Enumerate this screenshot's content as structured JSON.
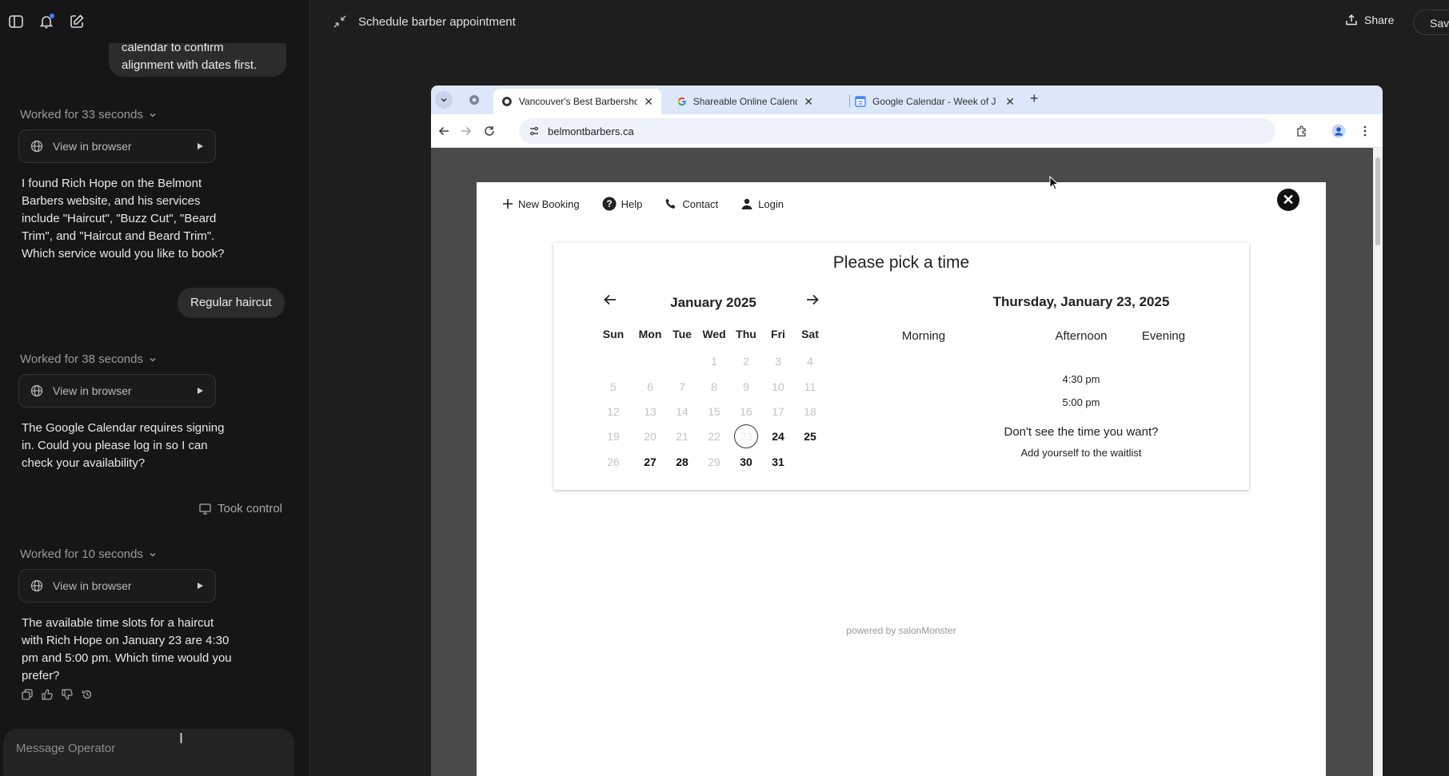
{
  "chat": {
    "partial_message": "calendar to confirm alignment with dates first.",
    "entries": [
      {
        "worked": "Worked for 33 seconds",
        "view_label": "View in browser",
        "message": "I found Rich Hope on the Belmont Barbers website, and his services include \"Haircut\", \"Buzz Cut\", \"Beard Trim\", and \"Haircut and Beard Trim\". Which service would you like to book?"
      },
      {
        "worked": "Worked for 38 seconds",
        "view_label": "View in browser",
        "message": "The Google Calendar requires signing in. Could you please log in so I can check your availability?"
      },
      {
        "worked": "Worked for 10 seconds",
        "view_label": "View in browser",
        "message": "The available time slots for a haircut with Rich Hope on January 23 are 4:30 pm and 5:00 pm. Which time would you prefer?"
      }
    ],
    "user_reply": "Regular haircut",
    "took_control": "Took control",
    "composer_placeholder": "Message Operator"
  },
  "main": {
    "title": "Schedule barber appointment",
    "share_label": "Share",
    "save_label": "Save"
  },
  "browser": {
    "tabs": [
      {
        "title": "Vancouver's Best Barbersho",
        "active": true
      },
      {
        "title": "Shareable Online Calendar a",
        "active": false
      },
      {
        "title": "Google Calendar - Week of J",
        "active": false
      }
    ],
    "url": "belmontbarbers.ca"
  },
  "booking": {
    "nav": {
      "new_booking": "New Booking",
      "help": "Help",
      "contact": "Contact",
      "login": "Login"
    },
    "title": "Please pick a time",
    "month": "January 2025",
    "weekdays": [
      "Sun",
      "Mon",
      "Tue",
      "Wed",
      "Thu",
      "Fri",
      "Sat"
    ],
    "weeks": [
      [
        null,
        null,
        null,
        {
          "d": "1",
          "s": "dis"
        },
        {
          "d": "2",
          "s": "dis"
        },
        {
          "d": "3",
          "s": "dis"
        },
        {
          "d": "4",
          "s": "dis"
        }
      ],
      [
        {
          "d": "5",
          "s": "dis"
        },
        {
          "d": "6",
          "s": "dis"
        },
        {
          "d": "7",
          "s": "dis"
        },
        {
          "d": "8",
          "s": "dis"
        },
        {
          "d": "9",
          "s": "dis"
        },
        {
          "d": "10",
          "s": "dis"
        },
        {
          "d": "11",
          "s": "dis"
        }
      ],
      [
        {
          "d": "12",
          "s": "dis"
        },
        {
          "d": "13",
          "s": "dis"
        },
        {
          "d": "14",
          "s": "dis"
        },
        {
          "d": "15",
          "s": "dis"
        },
        {
          "d": "16",
          "s": "dis"
        },
        {
          "d": "17",
          "s": "dis"
        },
        {
          "d": "18",
          "s": "dis"
        }
      ],
      [
        {
          "d": "19",
          "s": "dis"
        },
        {
          "d": "20",
          "s": "dis"
        },
        {
          "d": "21",
          "s": "dis"
        },
        {
          "d": "22",
          "s": "dis"
        },
        {
          "d": "23",
          "s": "sel"
        },
        {
          "d": "24",
          "s": "av"
        },
        {
          "d": "25",
          "s": "av"
        }
      ],
      [
        {
          "d": "26",
          "s": "dis"
        },
        {
          "d": "27",
          "s": "av"
        },
        {
          "d": "28",
          "s": "av"
        },
        {
          "d": "29",
          "s": "dis"
        },
        {
          "d": "30",
          "s": "av"
        },
        {
          "d": "31",
          "s": "av"
        },
        null
      ]
    ],
    "selected_date": "Thursday, January 23, 2025",
    "periods": [
      "Morning",
      "Afternoon",
      "Evening"
    ],
    "slots": [
      "4:30 pm",
      "5:00 pm"
    ],
    "no_time_text": "Don't see the time you want?",
    "waitlist_link": "Add yourself to the waitlist",
    "powered_by": "powered by salonMonster"
  }
}
